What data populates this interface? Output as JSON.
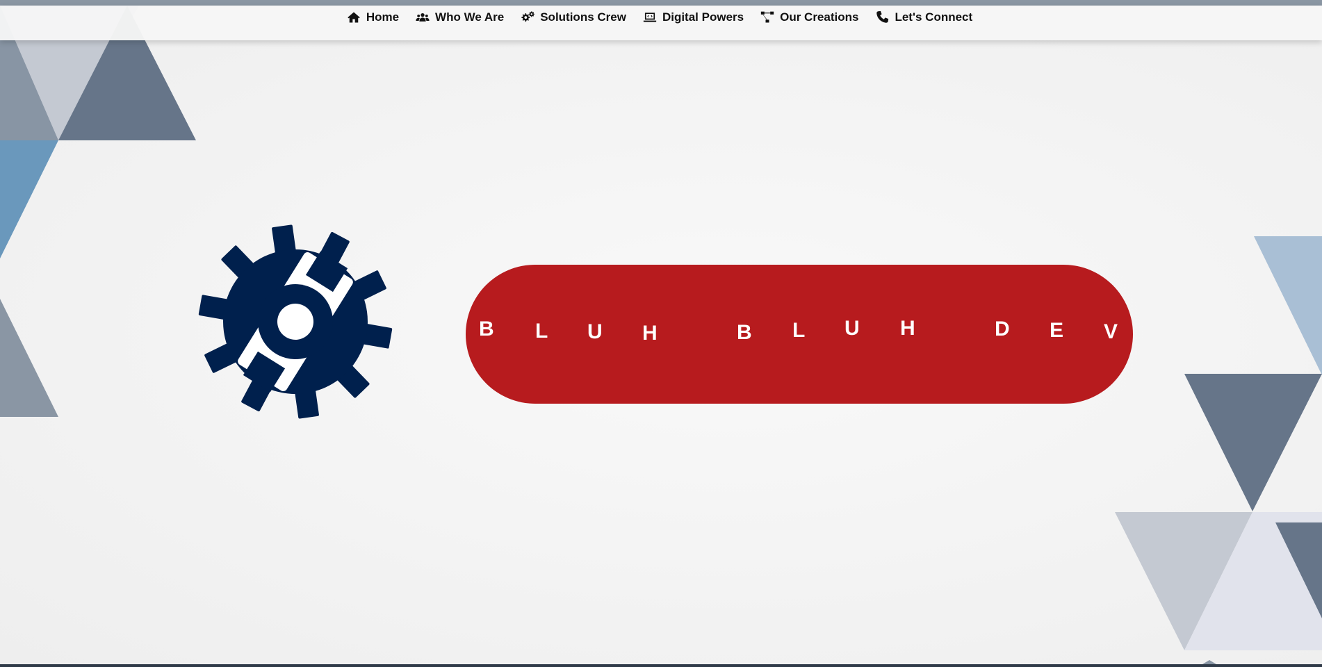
{
  "nav": {
    "items": [
      {
        "label": "Home",
        "icon": "home-icon"
      },
      {
        "label": "Who We Are",
        "icon": "users-icon"
      },
      {
        "label": "Solutions Crew",
        "icon": "gears-icon"
      },
      {
        "label": "Digital Powers",
        "icon": "laptop-code-icon"
      },
      {
        "label": "Our Creations",
        "icon": "project-diagram-icon"
      },
      {
        "label": "Let's Connect",
        "icon": "phone-icon"
      }
    ]
  },
  "hero": {
    "logo_icon": "gear-wrench-icon",
    "banner_letters": [
      "B",
      "L",
      "U",
      "H",
      "B",
      "L",
      "U",
      "H",
      "D",
      "E",
      "V"
    ]
  },
  "colors": {
    "banner": "#b71b1e",
    "gear": "#00204d",
    "triangle_dark": "#667589",
    "triangle_light": "#c4c9d2",
    "triangle_blue": "#6a98bc"
  }
}
